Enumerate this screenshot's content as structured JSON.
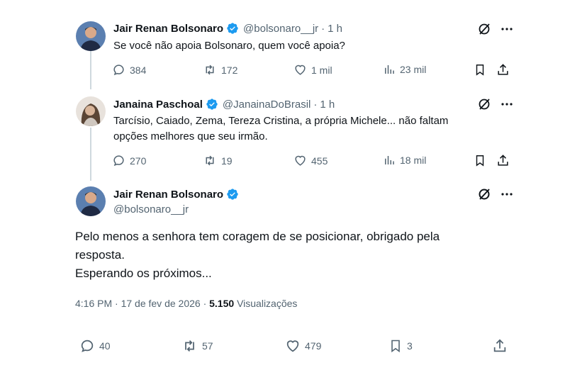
{
  "tweets": [
    {
      "name": "Jair Renan Bolsonaro",
      "handle": "@bolsonaro__jr",
      "dot": "·",
      "time": "1 h",
      "text": "Se você não apoia Bolsonaro, quem você apoia?",
      "replies": "384",
      "retweets": "172",
      "likes": "1 mil",
      "views": "23 mil"
    },
    {
      "name": "Janaina Paschoal",
      "handle": "@JanainaDoBrasil",
      "dot": "·",
      "time": "1 h",
      "text_line1": "Tarcísio, Caiado, Zema, Tereza Cristina, a própria Michele... não faltam",
      "text_line2": "opções melhores que seu irmão.",
      "replies": "270",
      "retweets": "19",
      "likes": "455",
      "views": "18 mil"
    }
  ],
  "main_tweet": {
    "name": "Jair Renan Bolsonaro",
    "handle": "@bolsonaro__jr",
    "text_line1": "Pelo menos a senhora tem coragem de se posicionar, obrigado pela",
    "text_line2": "resposta.",
    "text_line3": "Esperando os próximos...",
    "timestamp": "4:16 PM · 17 de fev de 2026 ·",
    "views_count": "5.150",
    "views_label": "Visualizações",
    "replies": "40",
    "retweets": "57",
    "likes": "479",
    "bookmarks": "3"
  },
  "colors": {
    "verified": "#1d9bf0",
    "secondary_text": "#536471",
    "primary_text": "#0f1419",
    "thread_line": "#cfd9de"
  }
}
